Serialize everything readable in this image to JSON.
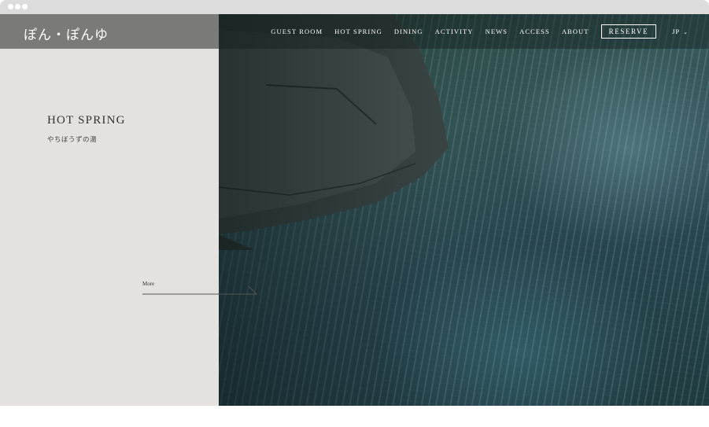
{
  "logo": "ぽん・ぽんゆ",
  "nav": {
    "items": [
      "GUEST ROOM",
      "HOT SPRING",
      "DINING",
      "ACTIVITY",
      "NEWS",
      "ACCESS",
      "ABOUT"
    ],
    "reserve_label": "RESERVE",
    "language": "JP"
  },
  "section": {
    "title": "HOT SPRING",
    "subtitle": "やちぼうずの湯",
    "more_label": "More"
  }
}
